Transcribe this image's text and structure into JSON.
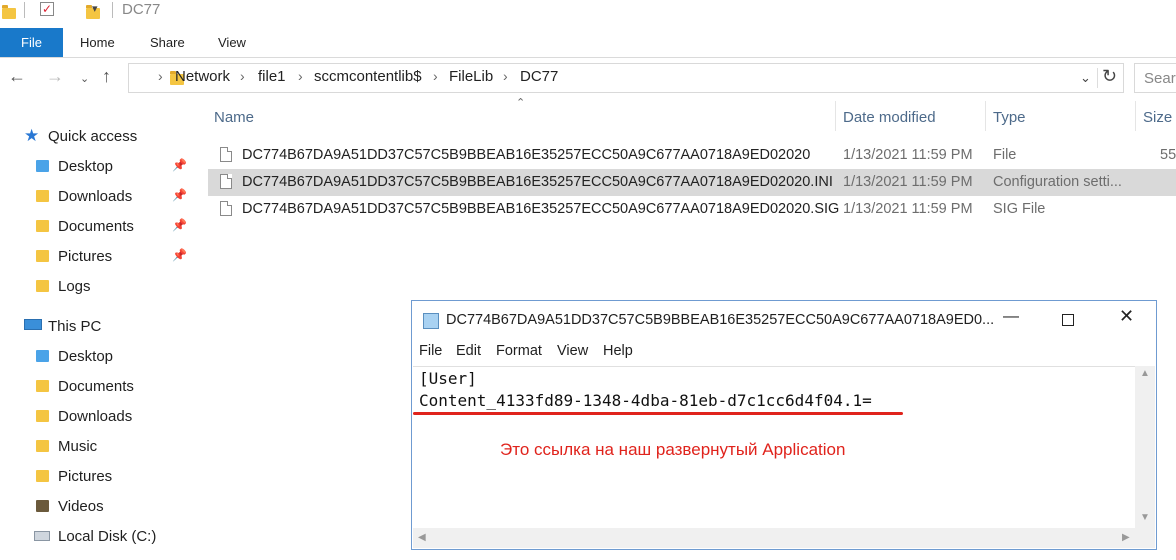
{
  "window": {
    "title": "DC77"
  },
  "ribbon": {
    "tabs": [
      "File",
      "Home",
      "Share",
      "View"
    ]
  },
  "address": {
    "crumbs": [
      "Network",
      "file1",
      "sccmcontentlib$",
      "FileLib",
      "DC77"
    ],
    "search_placeholder": "Sear"
  },
  "columns": {
    "name": "Name",
    "date": "Date modified",
    "type": "Type",
    "size": "Size"
  },
  "files": [
    {
      "name": "DC774B67DA9A51DD37C57C5B9BBEAB16E35257ECC50A9C677AA0718A9ED02020",
      "date": "1/13/2021 11:59 PM",
      "type": "File",
      "size": "55"
    },
    {
      "name": "DC774B67DA9A51DD37C57C5B9BBEAB16E35257ECC50A9C677AA0718A9ED02020.INI",
      "date": "1/13/2021 11:59 PM",
      "type": "Configuration setti...",
      "size": ""
    },
    {
      "name": "DC774B67DA9A51DD37C57C5B9BBEAB16E35257ECC50A9C677AA0718A9ED02020.SIG",
      "date": "1/13/2021 11:59 PM",
      "type": "SIG File",
      "size": ""
    }
  ],
  "sidebar": {
    "quick_access": "Quick access",
    "quick_items": [
      "Desktop",
      "Downloads",
      "Documents",
      "Pictures",
      "Logs"
    ],
    "this_pc": "This PC",
    "pc_items": [
      "Desktop",
      "Documents",
      "Downloads",
      "Music",
      "Pictures",
      "Videos",
      "Local Disk (C:)"
    ]
  },
  "notepad": {
    "title": "DC774B67DA9A51DD37C57C5B9BBEAB16E35257ECC50A9C677AA0718A9ED0...",
    "menu": [
      "File",
      "Edit",
      "Format",
      "View",
      "Help"
    ],
    "line1": "[User]",
    "line2": "Content_4133fd89-1348-4dba-81eb-d7c1cc6d4f04.1="
  },
  "annotation": "Это ссылка на наш развернутый Application",
  "colors": {
    "accent": "#1979ca",
    "annotation": "#e0231c"
  }
}
